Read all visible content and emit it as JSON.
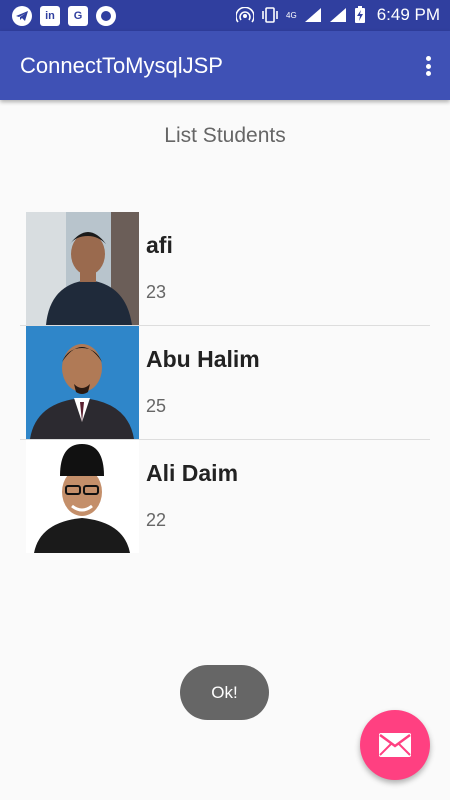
{
  "status_bar": {
    "time": "6:49 PM",
    "network": "4G",
    "icons": [
      "telegram-icon",
      "linkedin-icon",
      "google-plus-icon",
      "record-icon",
      "hotspot-icon",
      "vibrate-icon",
      "signal-icon",
      "battery-charging-icon"
    ]
  },
  "app_bar": {
    "title": "ConnectToMysqlJSP",
    "menu_icon": "more-vert-icon"
  },
  "main": {
    "heading": "List Students",
    "students": [
      {
        "name": "afi",
        "age": "23"
      },
      {
        "name": "Abu Halim",
        "age": "25"
      },
      {
        "name": "Ali Daim",
        "age": "22"
      }
    ]
  },
  "toast": {
    "text": "Ok!"
  },
  "fab": {
    "icon": "email-icon"
  },
  "colors": {
    "status_bar": "#303f9f",
    "app_bar": "#3f51b5",
    "fab": "#ff4081",
    "toast": "#666666"
  }
}
